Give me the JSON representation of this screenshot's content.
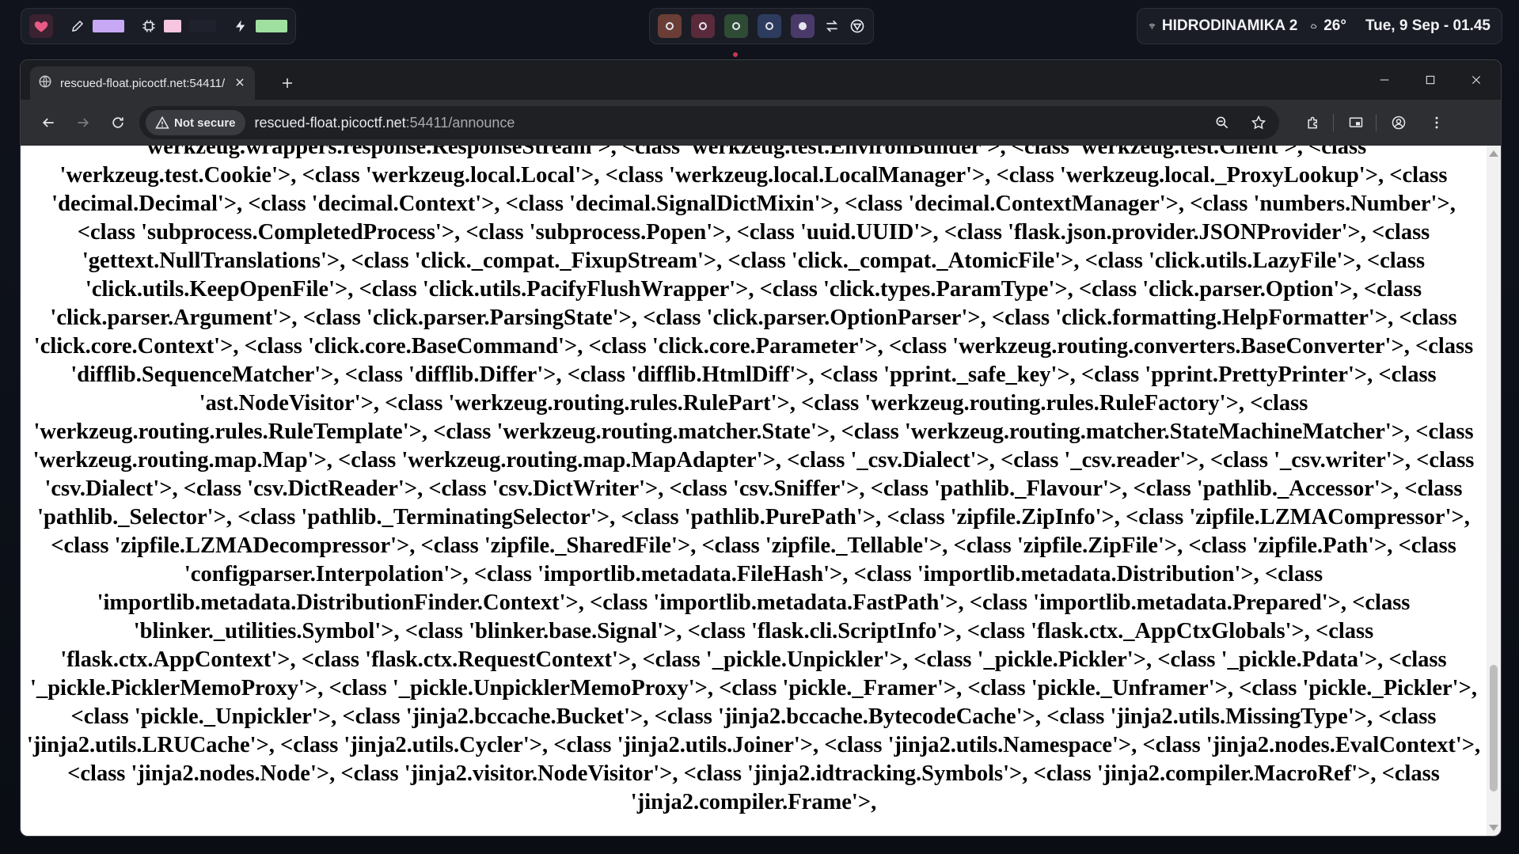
{
  "topbar": {
    "left_colors": {
      "heart": "#e95b86",
      "bar1": "#c6a8f5",
      "bar2": "#f6c6e0",
      "bar3": "#9fe0a0"
    },
    "workspaces": [
      {
        "color": "#6a3e36"
      },
      {
        "color": "#5b2a3a"
      },
      {
        "color": "#2e4b34"
      },
      {
        "color": "#2d3c5e"
      },
      {
        "color": "#4a3a6a"
      }
    ],
    "network": "HIDRODINAMIKA 2",
    "temperature": "26°",
    "datetime": "Tue, 9 Sep - 01.45"
  },
  "browser": {
    "tab_title": "rescued-float.picoctf.net:54411/",
    "security_label": "Not secure",
    "url_host": "rescued-float.picoctf.net",
    "url_path": ":54411/announce"
  },
  "page": {
    "content": " 'werkzeug.wrappers.response.ResponseStream'>, <class 'werkzeug.test.EnvironBuilder'>, <class 'werkzeug.test.Client'>, <class 'werkzeug.test.Cookie'>, <class 'werkzeug.local.Local'>, <class 'werkzeug.local.LocalManager'>, <class 'werkzeug.local._ProxyLookup'>, <class 'decimal.Decimal'>, <class 'decimal.Context'>, <class 'decimal.SignalDictMixin'>, <class 'decimal.ContextManager'>, <class 'numbers.Number'>, <class 'subprocess.CompletedProcess'>, <class 'subprocess.Popen'>, <class 'uuid.UUID'>, <class 'flask.json.provider.JSONProvider'>, <class 'gettext.NullTranslations'>, <class 'click._compat._FixupStream'>, <class 'click._compat._AtomicFile'>, <class 'click.utils.LazyFile'>, <class 'click.utils.KeepOpenFile'>, <class 'click.utils.PacifyFlushWrapper'>, <class 'click.types.ParamType'>, <class 'click.parser.Option'>, <class 'click.parser.Argument'>, <class 'click.parser.ParsingState'>, <class 'click.parser.OptionParser'>, <class 'click.formatting.HelpFormatter'>, <class 'click.core.Context'>, <class 'click.core.BaseCommand'>, <class 'click.core.Parameter'>, <class 'werkzeug.routing.converters.BaseConverter'>, <class 'difflib.SequenceMatcher'>, <class 'difflib.Differ'>, <class 'difflib.HtmlDiff'>, <class 'pprint._safe_key'>, <class 'pprint.PrettyPrinter'>, <class 'ast.NodeVisitor'>, <class 'werkzeug.routing.rules.RulePart'>, <class 'werkzeug.routing.rules.RuleFactory'>, <class 'werkzeug.routing.rules.RuleTemplate'>, <class 'werkzeug.routing.matcher.State'>, <class 'werkzeug.routing.matcher.StateMachineMatcher'>, <class 'werkzeug.routing.map.Map'>, <class 'werkzeug.routing.map.MapAdapter'>, <class '_csv.Dialect'>, <class '_csv.reader'>, <class '_csv.writer'>, <class 'csv.Dialect'>, <class 'csv.DictReader'>, <class 'csv.DictWriter'>, <class 'csv.Sniffer'>, <class 'pathlib._Flavour'>, <class 'pathlib._Accessor'>, <class 'pathlib._Selector'>, <class 'pathlib._TerminatingSelector'>, <class 'pathlib.PurePath'>, <class 'zipfile.ZipInfo'>, <class 'zipfile.LZMACompressor'>, <class 'zipfile.LZMADecompressor'>, <class 'zipfile._SharedFile'>, <class 'zipfile._Tellable'>, <class 'zipfile.ZipFile'>, <class 'zipfile.Path'>, <class 'configparser.Interpolation'>, <class 'importlib.metadata.FileHash'>, <class 'importlib.metadata.Distribution'>, <class 'importlib.metadata.DistributionFinder.Context'>, <class 'importlib.metadata.FastPath'>, <class 'importlib.metadata.Prepared'>, <class 'blinker._utilities.Symbol'>, <class 'blinker.base.Signal'>, <class 'flask.cli.ScriptInfo'>, <class 'flask.ctx._AppCtxGlobals'>, <class 'flask.ctx.AppContext'>, <class 'flask.ctx.RequestContext'>, <class '_pickle.Unpickler'>, <class '_pickle.Pickler'>, <class '_pickle.Pdata'>, <class '_pickle.PicklerMemoProxy'>, <class '_pickle.UnpicklerMemoProxy'>, <class 'pickle._Framer'>, <class 'pickle._Unframer'>, <class 'pickle._Pickler'>, <class 'pickle._Unpickler'>, <class 'jinja2.bccache.Bucket'>, <class 'jinja2.bccache.BytecodeCache'>, <class 'jinja2.utils.MissingType'>, <class 'jinja2.utils.LRUCache'>, <class 'jinja2.utils.Cycler'>, <class 'jinja2.utils.Joiner'>, <class 'jinja2.utils.Namespace'>, <class 'jinja2.nodes.EvalContext'>, <class 'jinja2.nodes.Node'>, <class 'jinja2.visitor.NodeVisitor'>, <class 'jinja2.idtracking.Symbols'>, <class 'jinja2.compiler.MacroRef'>, <class 'jinja2.compiler.Frame'>,"
  }
}
